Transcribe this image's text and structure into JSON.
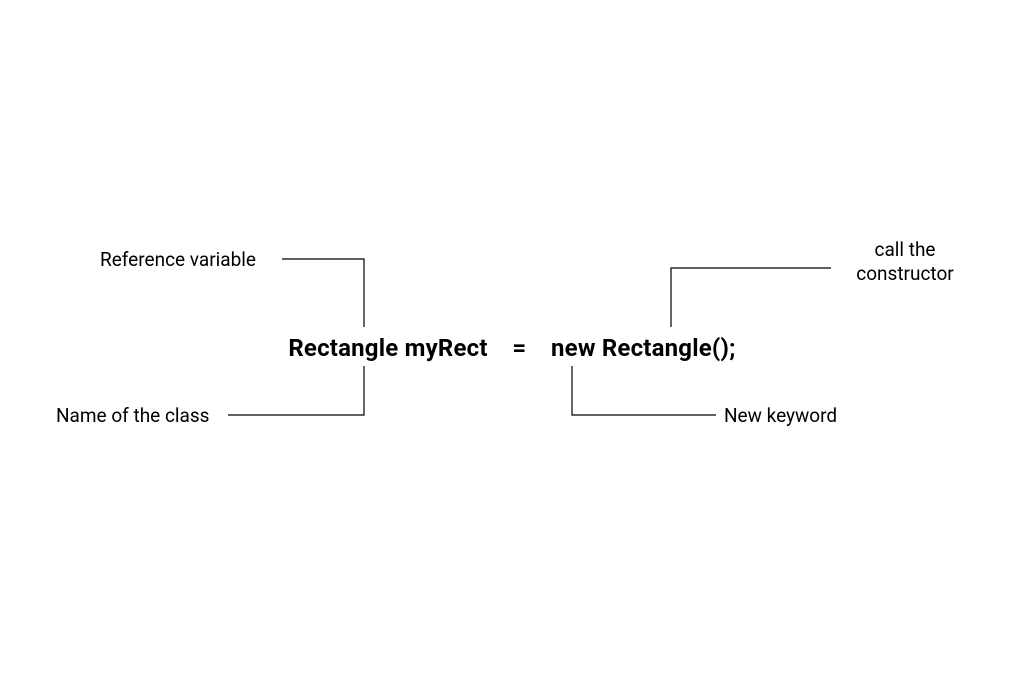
{
  "code": {
    "class_name": "Rectangle",
    "var_name": "myRect",
    "equals": "=",
    "new_keyword": "new",
    "constructor_call": "Rectangle();"
  },
  "labels": {
    "reference_variable": "Reference variable",
    "class_name": "Name of the class",
    "call_constructor_line1": "call the",
    "call_constructor_line2": "constructor",
    "new_keyword": "New keyword"
  }
}
